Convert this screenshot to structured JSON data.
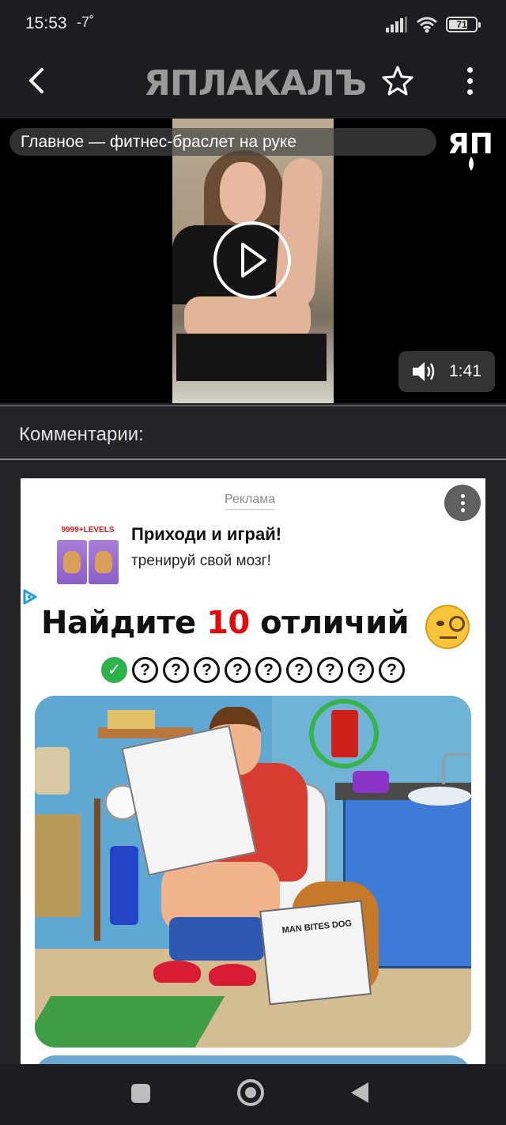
{
  "status_bar": {
    "time": "15:53",
    "temperature": "-7˚",
    "battery_text": "71",
    "battery_level": 0.71
  },
  "header": {
    "logo_text": "ЯПЛАКАЛЪ",
    "icons": [
      "back-arrow-icon",
      "star-icon",
      "more-vertical-icon"
    ]
  },
  "video": {
    "title": "Главное — фитнес-браслет на руке",
    "badge_text": "ЯП",
    "duration": "1:41",
    "icons": [
      "play-icon",
      "volume-icon"
    ]
  },
  "comments": {
    "title": "Комментарии:"
  },
  "ad": {
    "label": "Реклама",
    "app_badge": "9999+LEVELS",
    "headline": "Приходи и играй!",
    "subline": "тренируй свой мозг!",
    "big_title_prefix": "Найдите ",
    "big_title_number": "10",
    "big_title_suffix": " отличий",
    "found_count": 1,
    "total_count": 10,
    "unknown_mark": "?",
    "dog_paper_text": "MAN BITES DOG",
    "colors": {
      "found": "#2bb34a",
      "highlight_number": "#e10d0d"
    }
  },
  "nav_bar": {
    "icons": [
      "recents-icon",
      "home-icon",
      "back-icon"
    ]
  }
}
